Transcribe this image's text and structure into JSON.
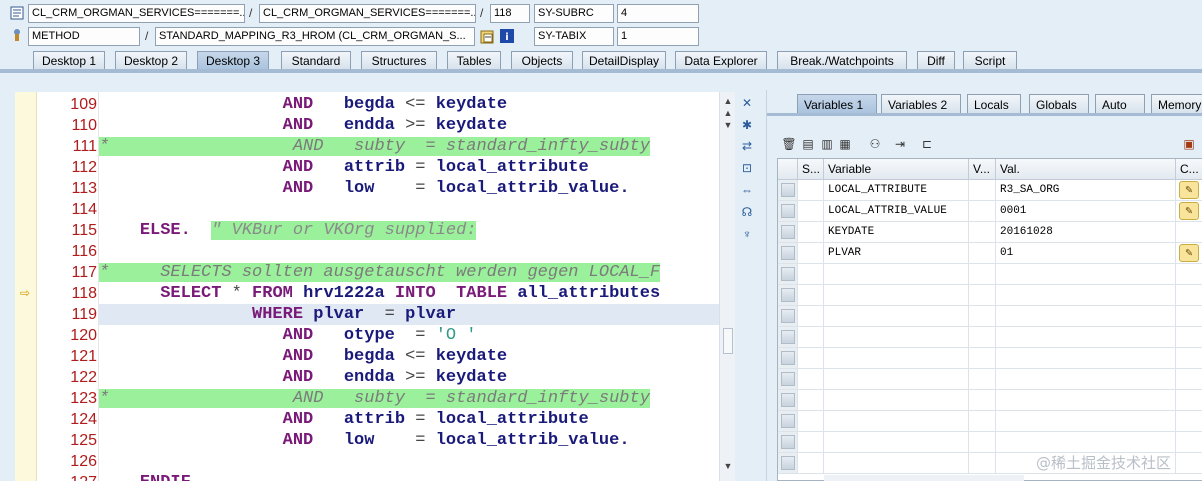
{
  "header": {
    "row1": {
      "program": "CL_CRM_ORGMAN_SERVICES=======...",
      "include": "CL_CRM_ORGMAN_SERVICES=======...",
      "line": "118",
      "sysfield": "SY-SUBRC",
      "sysvalue": "4"
    },
    "row2": {
      "event_type": "METHOD",
      "event": "STANDARD_MAPPING_R3_HROM (CL_CRM_ORGMAN_S...",
      "sysfield": "SY-TABIX",
      "sysvalue": "1"
    }
  },
  "tabs": [
    "Desktop 1",
    "Desktop 2",
    "Desktop 3",
    "Standard",
    "Structures",
    "Tables",
    "Objects",
    "DetailDisplay",
    "Data Explorer",
    "Break./Watchpoints",
    "Diff",
    "Script"
  ],
  "active_tab": "Desktop 3",
  "code": {
    "lines": [
      {
        "num": "109",
        "text": "                  AND   begda <= keydate"
      },
      {
        "num": "110",
        "text": "                  AND   endda >= keydate"
      },
      {
        "num": "111",
        "text": "*                  AND   subty  = standard_infty_subty",
        "comment": true
      },
      {
        "num": "112",
        "text": "                  AND   attrib = local_attribute"
      },
      {
        "num": "113",
        "text": "                  AND   low    = local_attrib_value."
      },
      {
        "num": "114",
        "text": ""
      },
      {
        "num": "115",
        "text": "    ELSE.  \" VKBur or VKOrg supplied:"
      },
      {
        "num": "116",
        "text": ""
      },
      {
        "num": "117",
        "text": "*     SELECTS sollten ausgetauscht werden gegen LOCAL_F",
        "comment": true
      },
      {
        "num": "118",
        "text": "      SELECT * FROM hrv1222a INTO  TABLE all_attributes",
        "arrow": true
      },
      {
        "num": "119",
        "text": "               WHERE plvar  = plvar",
        "current": true
      },
      {
        "num": "120",
        "text": "                  AND   otype  = 'O '"
      },
      {
        "num": "121",
        "text": "                  AND   begda <= keydate"
      },
      {
        "num": "122",
        "text": "                  AND   endda >= keydate"
      },
      {
        "num": "123",
        "text": "*                  AND   subty  = standard_infty_subty",
        "comment": true
      },
      {
        "num": "124",
        "text": "                  AND   attrib = local_attribute"
      },
      {
        "num": "125",
        "text": "                  AND   low    = local_attrib_value."
      },
      {
        "num": "126",
        "text": ""
      },
      {
        "num": "127",
        "text": "    ENDIF."
      }
    ]
  },
  "right_tabs": [
    "Variables 1",
    "Variables 2",
    "Locals",
    "Globals",
    "Auto",
    "Memory"
  ],
  "right_active_tab": "Variables 1",
  "grid": {
    "headers": {
      "s": "S...",
      "variable": "Variable",
      "v": "V...",
      "val": "Val.",
      "c": "C..."
    },
    "rows": [
      {
        "variable": "LOCAL_ATTRIBUTE",
        "val": "R3_SA_ORG",
        "edit": true
      },
      {
        "variable": "LOCAL_ATTRIB_VALUE",
        "val": "0001",
        "edit": true
      },
      {
        "variable": "KEYDATE",
        "val": "20161028",
        "edit": false
      },
      {
        "variable": "PLVAR",
        "val": "01",
        "edit": true
      }
    ]
  },
  "watermark": "@稀土掘金技术社区"
}
